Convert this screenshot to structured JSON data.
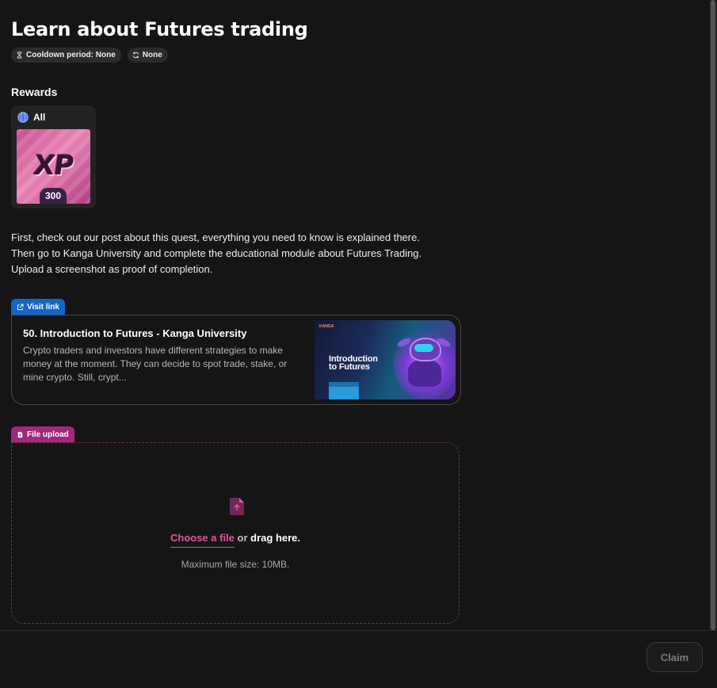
{
  "quest": {
    "title": "Learn about Futures trading",
    "cooldown_label": "Cooldown period: None",
    "repeat_label": "None"
  },
  "rewards": {
    "heading": "Rewards",
    "scope_label": "All",
    "xp_text": "XP",
    "xp_amount": "300"
  },
  "description": {
    "line1": "First, check out our post about this quest,  everything you need to know is explained there.",
    "line2": "Then go to Kanga University and complete the educational module about Futures Trading.",
    "line3": "Upload a screenshot as proof of completion."
  },
  "visit_link": {
    "tag_label": "Visit link",
    "title": "50. Introduction to Futures - Kanga University",
    "description": "Crypto traders and investors have different strategies to make money at the moment. They can decide to spot trade, stake, or mine crypto. Still, crypt...",
    "thumbnail_title_line1": "Introduction",
    "thumbnail_title_line2": "to Futures",
    "thumbnail_brand": "KANGA"
  },
  "file_upload": {
    "tag_label": "File upload",
    "choose_label": "Choose a file",
    "or_label": "or",
    "drag_label": "drag here.",
    "max_size": "Maximum file size: 10MB."
  },
  "footer": {
    "claim_label": "Claim"
  },
  "colors": {
    "background": "#151515",
    "link_tag": "#1565c7",
    "upload_tag": "#a3287a",
    "accent_pink": "#e0559f"
  }
}
